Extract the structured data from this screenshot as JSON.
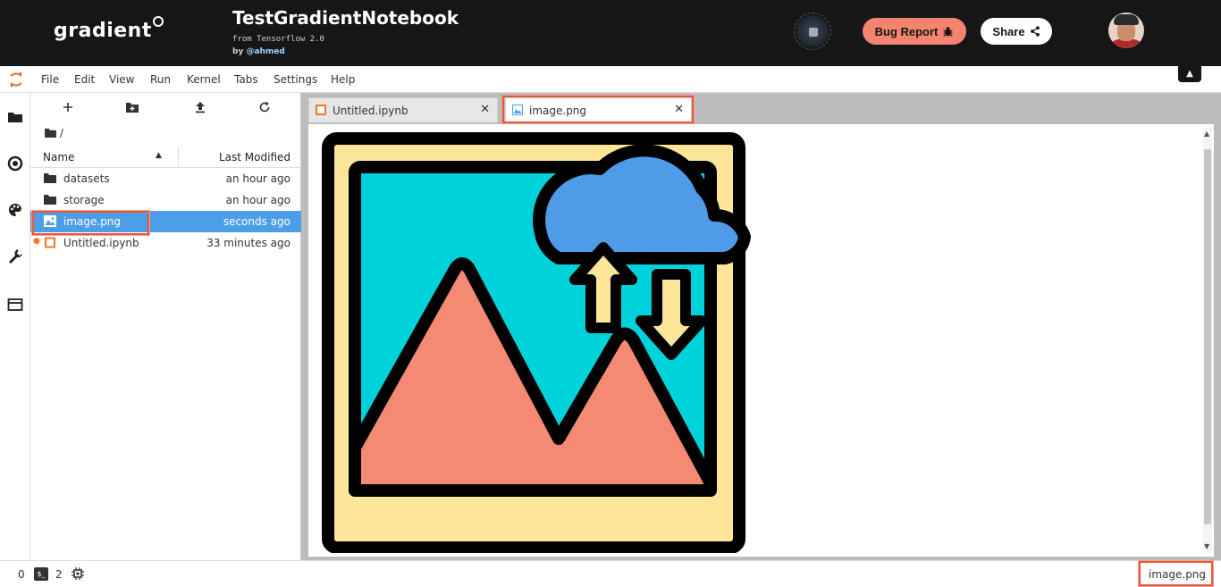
{
  "header": {
    "brand": "gradient",
    "notebook_title": "TestGradientNotebook",
    "subtitle": "from Tensorflow 2.0",
    "by_prefix": "by",
    "author": "@ahmed",
    "bug_report_label": "Bug Report",
    "share_label": "Share"
  },
  "menu": {
    "items": [
      "File",
      "Edit",
      "View",
      "Run",
      "Kernel",
      "Tabs",
      "Settings",
      "Help"
    ]
  },
  "file_browser": {
    "breadcrumb": "/",
    "columns": {
      "name": "Name",
      "modified": "Last Modified"
    },
    "rows": [
      {
        "name": "datasets",
        "modified": "an hour ago",
        "kind": "folder"
      },
      {
        "name": "storage",
        "modified": "an hour ago",
        "kind": "folder"
      },
      {
        "name": "image.png",
        "modified": "seconds ago",
        "kind": "image"
      },
      {
        "name": "Untitled.ipynb",
        "modified": "33 minutes ago",
        "kind": "notebook"
      }
    ]
  },
  "tabs": [
    {
      "label": "Untitled.ipynb",
      "kind": "notebook"
    },
    {
      "label": "image.png",
      "kind": "image"
    }
  ],
  "status": {
    "left_count": "0",
    "terminal_count": "2",
    "right_label": "image.png"
  },
  "colors": {
    "header_bg": "#161616",
    "bug_report": "#f4836f",
    "selection": "#4d9ee8",
    "highlight": "#e8583c",
    "image_sky": "#00d2dc",
    "image_mountain": "#f48a74",
    "image_frame": "#fde599",
    "image_cloud": "#4f9be8"
  }
}
